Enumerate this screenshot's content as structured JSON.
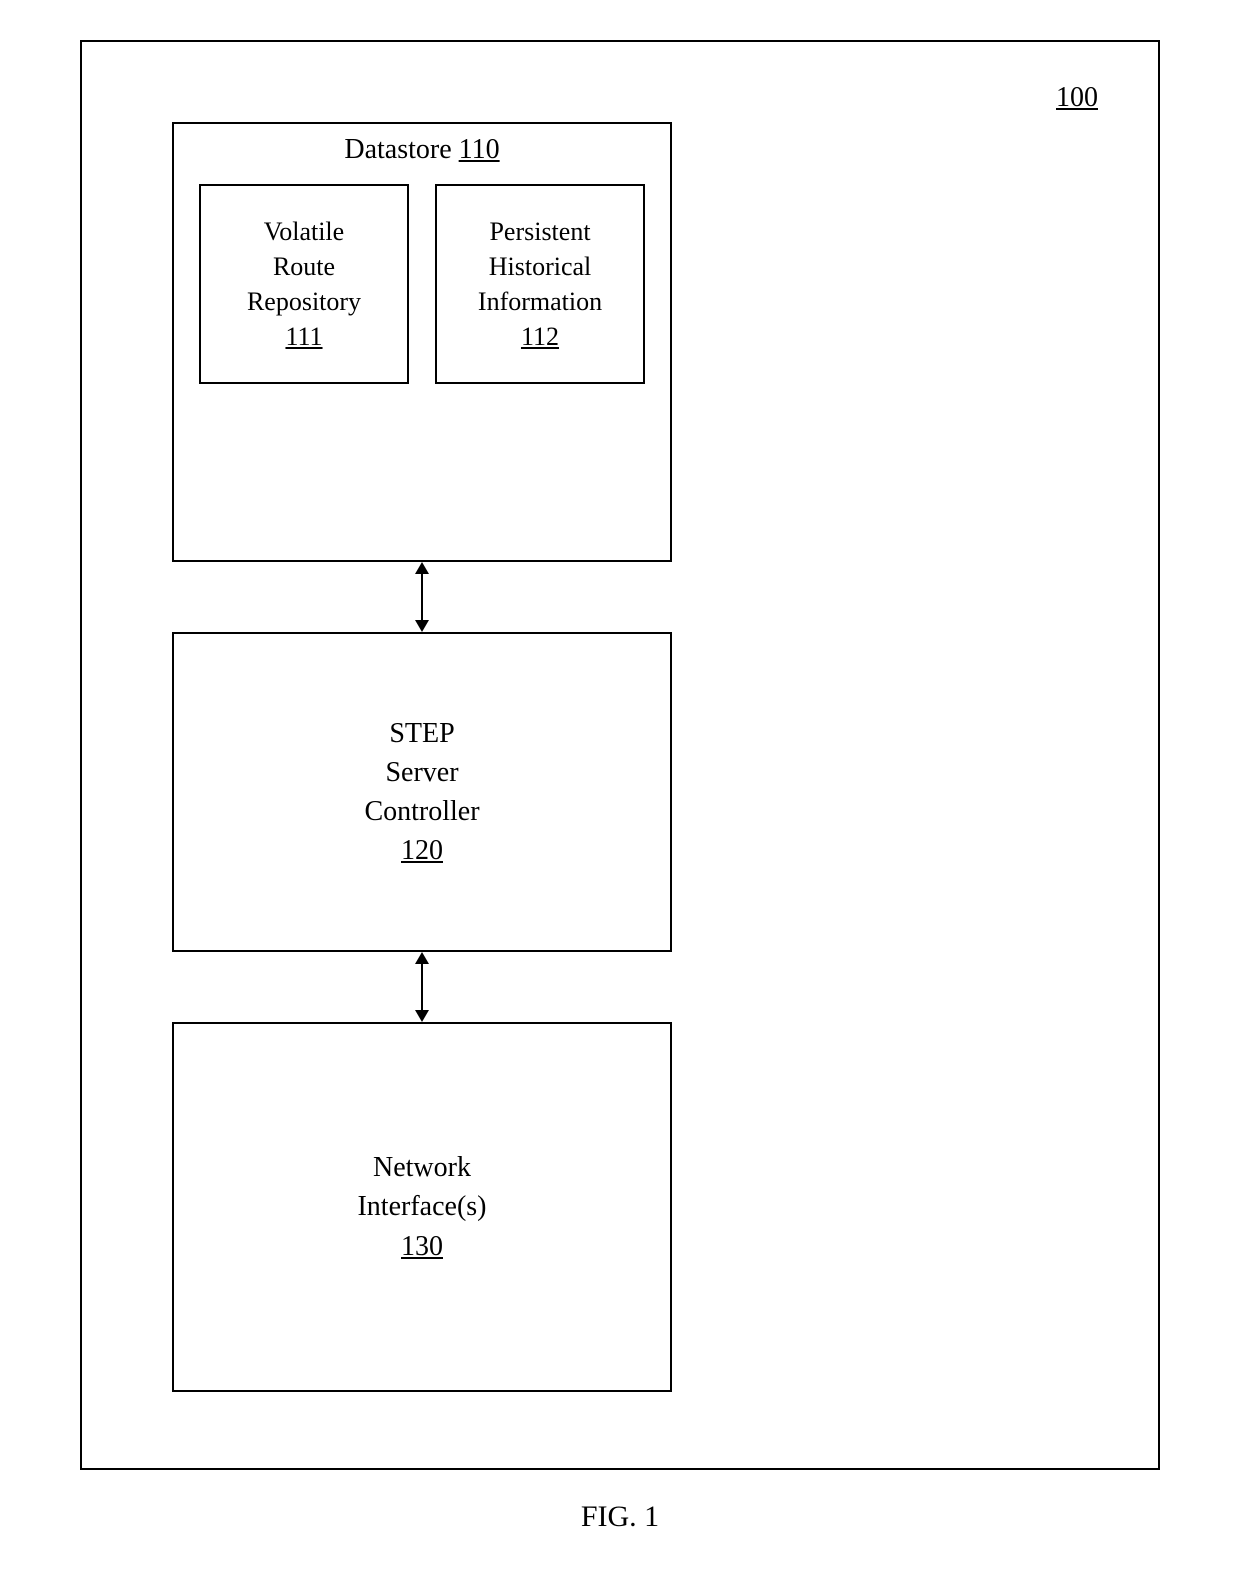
{
  "figure_ref": "100",
  "datastore": {
    "title": "Datastore",
    "ref": "110",
    "volatile": {
      "line1": "Volatile",
      "line2": "Route",
      "line3": "Repository",
      "ref": "111"
    },
    "persistent": {
      "line1": "Persistent",
      "line2": "Historical",
      "line3": "Information",
      "ref": "112"
    }
  },
  "step": {
    "line1": "STEP",
    "line2": "Server",
    "line3": "Controller",
    "ref": "120"
  },
  "network": {
    "line1": "Network",
    "line2": "Interface(s)",
    "ref": "130"
  },
  "caption": "FIG. 1"
}
